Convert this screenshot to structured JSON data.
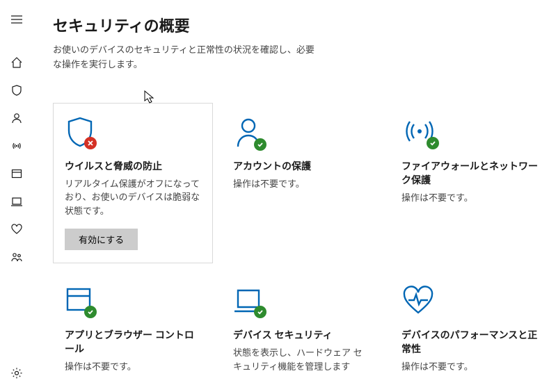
{
  "colors": {
    "accent": "#0066b4",
    "ok": "#2e8b2e",
    "error": "#d43125"
  },
  "header": {
    "title": "セキュリティの概要",
    "subtitle": "お使いのデバイスのセキュリティと正常性の状況を確認し、必要な操作を実行します。"
  },
  "sidebar": {
    "items": [
      {
        "name": "menu-icon"
      },
      {
        "name": "home-icon"
      },
      {
        "name": "shield-icon"
      },
      {
        "name": "account-icon"
      },
      {
        "name": "wifi-icon"
      },
      {
        "name": "app-browser-icon"
      },
      {
        "name": "device-icon"
      },
      {
        "name": "heart-icon"
      },
      {
        "name": "family-icon"
      }
    ],
    "footer": {
      "name": "settings-icon"
    }
  },
  "cards": [
    {
      "icon": "shield",
      "status": "error",
      "title": "ウイルスと脅威の防止",
      "desc": "リアルタイム保護がオフになっており、お使いのデバイスは脆弱な状態です。",
      "button": "有効にする",
      "bordered": true
    },
    {
      "icon": "account",
      "status": "ok",
      "title": "アカウントの保護",
      "desc": "操作は不要です。"
    },
    {
      "icon": "firewall",
      "status": "ok",
      "title": "ファイアウォールとネットワーク保護",
      "desc": "操作は不要です。"
    },
    {
      "icon": "appbrowser",
      "status": "ok",
      "title": "アプリとブラウザー コントロール",
      "desc": "操作は不要です。"
    },
    {
      "icon": "device",
      "status": "ok",
      "title": "デバイス セキュリティ",
      "desc": "状態を表示し、ハードウェア セキュリティ機能を管理します"
    },
    {
      "icon": "heart",
      "status": "none",
      "title": "デバイスのパフォーマンスと正常性",
      "desc": "操作は不要です。"
    }
  ]
}
